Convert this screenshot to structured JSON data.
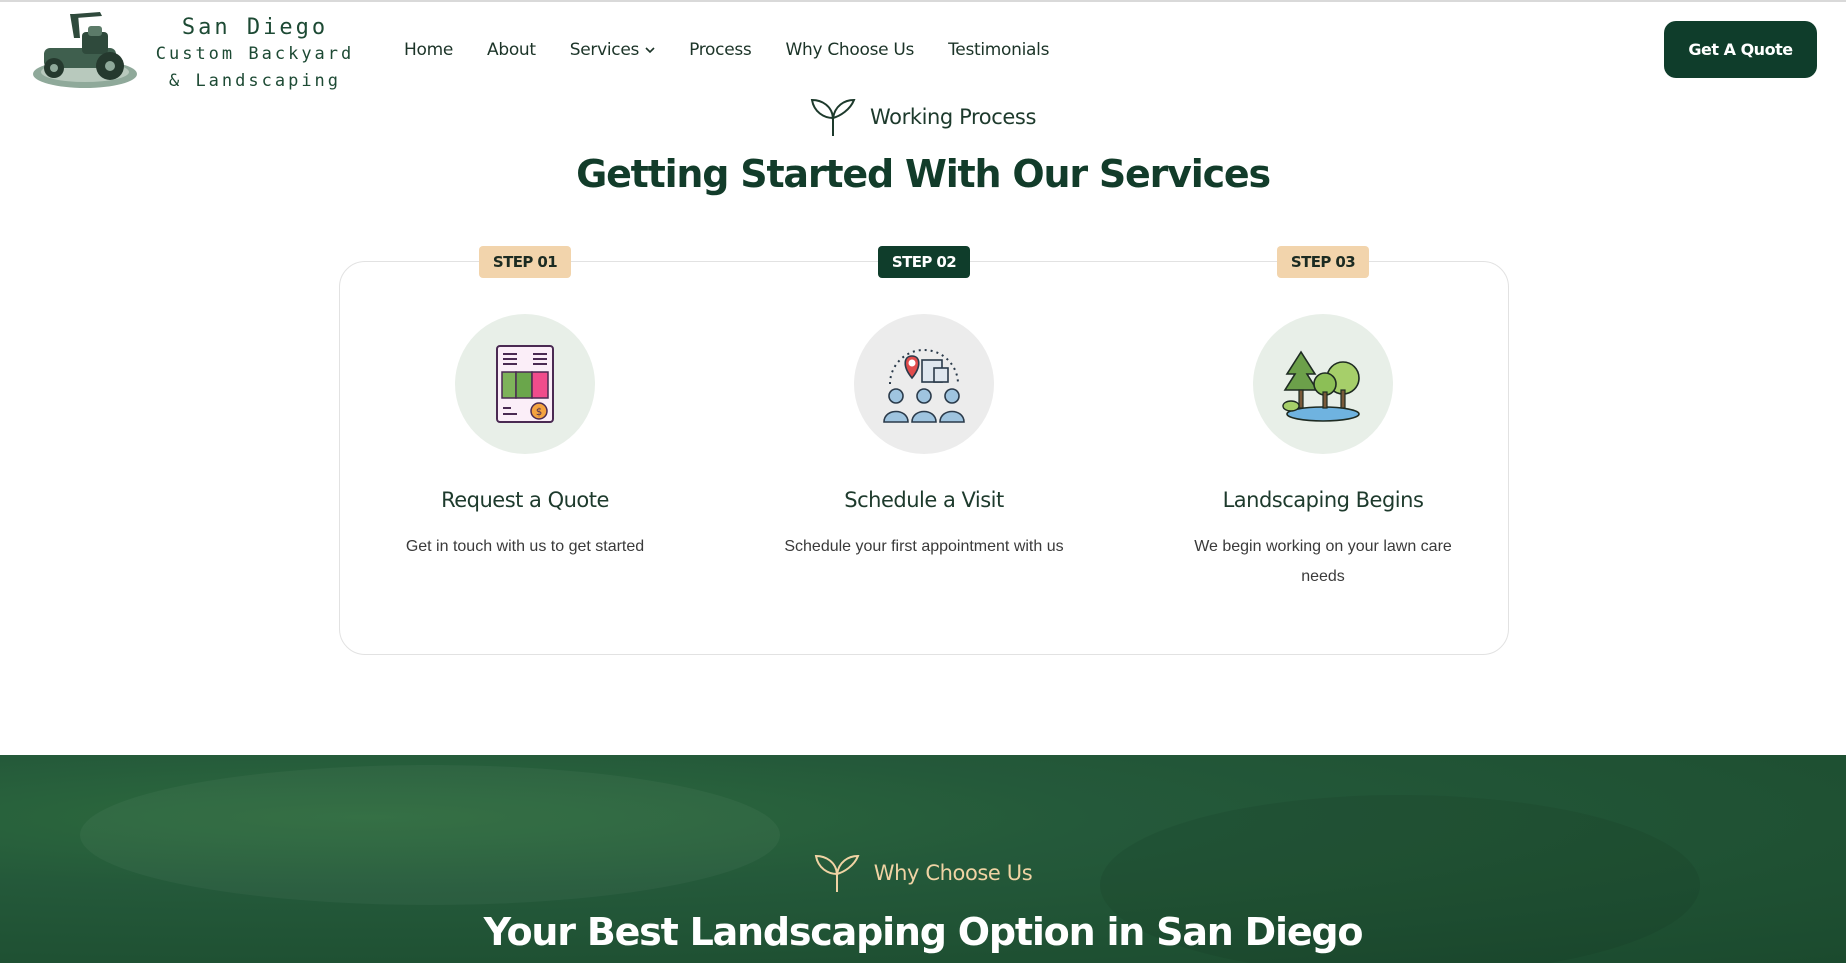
{
  "brand": {
    "line1": "San Diego",
    "line2": "Custom Backyard",
    "line3": "& Landscaping"
  },
  "nav": {
    "items": [
      {
        "label": "Home"
      },
      {
        "label": "About"
      },
      {
        "label": "Services",
        "has_dropdown": true
      },
      {
        "label": "Process"
      },
      {
        "label": "Why Choose Us"
      },
      {
        "label": "Testimonials"
      }
    ],
    "cta_label": "Get A Quote"
  },
  "process": {
    "eyebrow": "Working Process",
    "title": "Getting Started With Our Services",
    "steps": [
      {
        "badge": "STEP 01",
        "title": "Request a Quote",
        "description": "Get in touch with us to get started",
        "icon": "quote-document-icon"
      },
      {
        "badge": "STEP 02",
        "title": "Schedule a Visit",
        "description": "Schedule your first appointment with us",
        "icon": "team-location-icon"
      },
      {
        "badge": "STEP 03",
        "title": "Landscaping Begins",
        "description": "We begin working on your lawn care needs",
        "icon": "trees-pond-icon"
      }
    ]
  },
  "why": {
    "eyebrow": "Why Choose Us",
    "title": "Your Best Landscaping Option in San Diego"
  },
  "colors": {
    "brand_dark": "#0f3d2b",
    "badge_light": "#f2d4ac",
    "accent_cream": "#f0d3a4",
    "green_band": "#1f5133"
  }
}
